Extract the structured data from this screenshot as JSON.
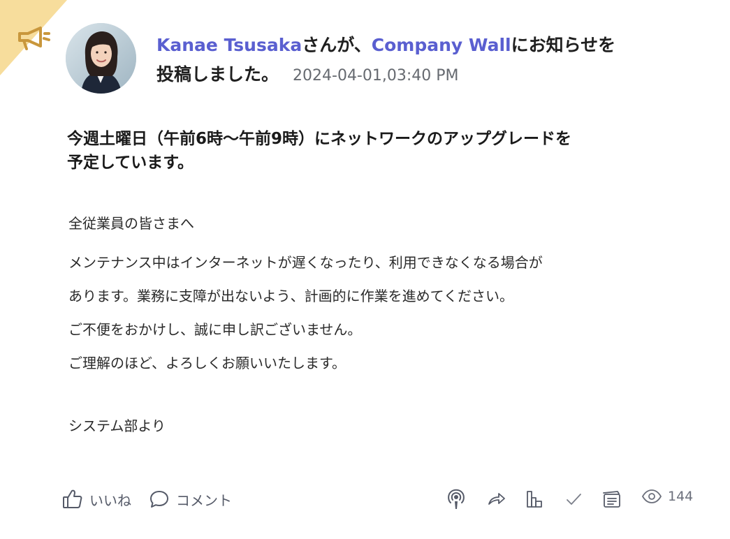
{
  "post": {
    "author": "Kanae Tsusaka",
    "author_suffix": "さんが、",
    "wall": "Company Wall",
    "action_line1": "にお知らせを",
    "action_line2": "投稿しました。",
    "timestamp": "2024-04-01,03:40 PM",
    "title_line1": "今週土曜日（午前6時〜午前9時）にネットワークのアップグレードを",
    "title_line2": "予定しています。",
    "body": {
      "greeting": "全従業員の皆さまへ",
      "lines": [
        "メンテナンス中はインターネットが遅くなったり、利用できなくなる場合が",
        "あります。業務に支障が出ないよう、計画的に作業を進めてください。",
        "ご不便をおかけし、誠に申し訳ございません。",
        "ご理解のほど、よろしくお願いいたします。"
      ],
      "signature": "システム部より"
    }
  },
  "footer": {
    "like_label": "いいね",
    "comment_label": "コメント",
    "view_count": "144"
  },
  "colors": {
    "link": "#5a5fd0",
    "ribbon": "#f7dd9c",
    "megaphone": "#c9973c",
    "icon": "#555a68"
  },
  "icons": {
    "announcement": "megaphone-icon",
    "like": "thumbs-up-icon",
    "comment": "speech-bubble-icon",
    "broadcast": "podcast-icon",
    "share": "share-arrow-icon",
    "stats": "bar-chart-icon",
    "confirm": "checkmark-icon",
    "notes": "notes-icon",
    "views": "eye-icon"
  }
}
